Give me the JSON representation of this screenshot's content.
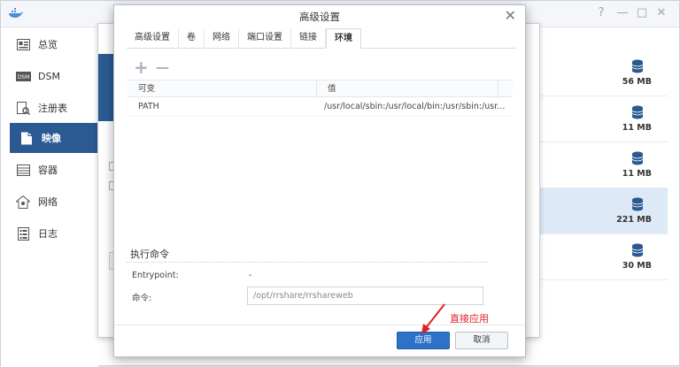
{
  "app": {
    "window_controls": [
      "?",
      "—",
      "□",
      "✕"
    ],
    "sidebar": [
      {
        "label": "总览",
        "icon": "overview-icon"
      },
      {
        "label": "DSM",
        "icon": "dsm-icon"
      },
      {
        "label": "注册表",
        "icon": "registry-icon"
      },
      {
        "label": "映像",
        "icon": "image-icon",
        "active": true
      },
      {
        "label": "容器",
        "icon": "container-icon"
      },
      {
        "label": "网络",
        "icon": "network-icon"
      },
      {
        "label": "日志",
        "icon": "log-icon"
      }
    ],
    "image_sizes": [
      "56 MB",
      "11 MB",
      "11 MB",
      "221 MB",
      "30 MB"
    ],
    "selected_row": 3
  },
  "dialog": {
    "title": "高级设置",
    "close": "✕",
    "tabs": [
      {
        "label": "高级设置"
      },
      {
        "label": "卷"
      },
      {
        "label": "网络"
      },
      {
        "label": "端口设置"
      },
      {
        "label": "链接"
      },
      {
        "label": "环境",
        "active": true
      }
    ],
    "toolbar": {
      "add": "+",
      "remove": "—"
    },
    "grid": {
      "columns": [
        "可变",
        "值"
      ],
      "rows": [
        {
          "variable": "PATH",
          "value": "/usr/local/sbin:/usr/local/bin:/usr/sbin:/usr..."
        }
      ]
    },
    "exec": {
      "section_title": "执行命令",
      "entrypoint_label": "Entrypoint:",
      "entrypoint_value": "-",
      "command_label": "命令:",
      "command_value": "/opt/rrshare/rrshareweb"
    },
    "buttons": {
      "apply": "应用",
      "cancel": "取消"
    }
  },
  "annotation": {
    "text": "直接应用",
    "color": "#dd2222"
  },
  "colors": {
    "accent": "#2b5a93",
    "apply_button": "#2e72c8",
    "selected_row": "#dde9f6"
  }
}
